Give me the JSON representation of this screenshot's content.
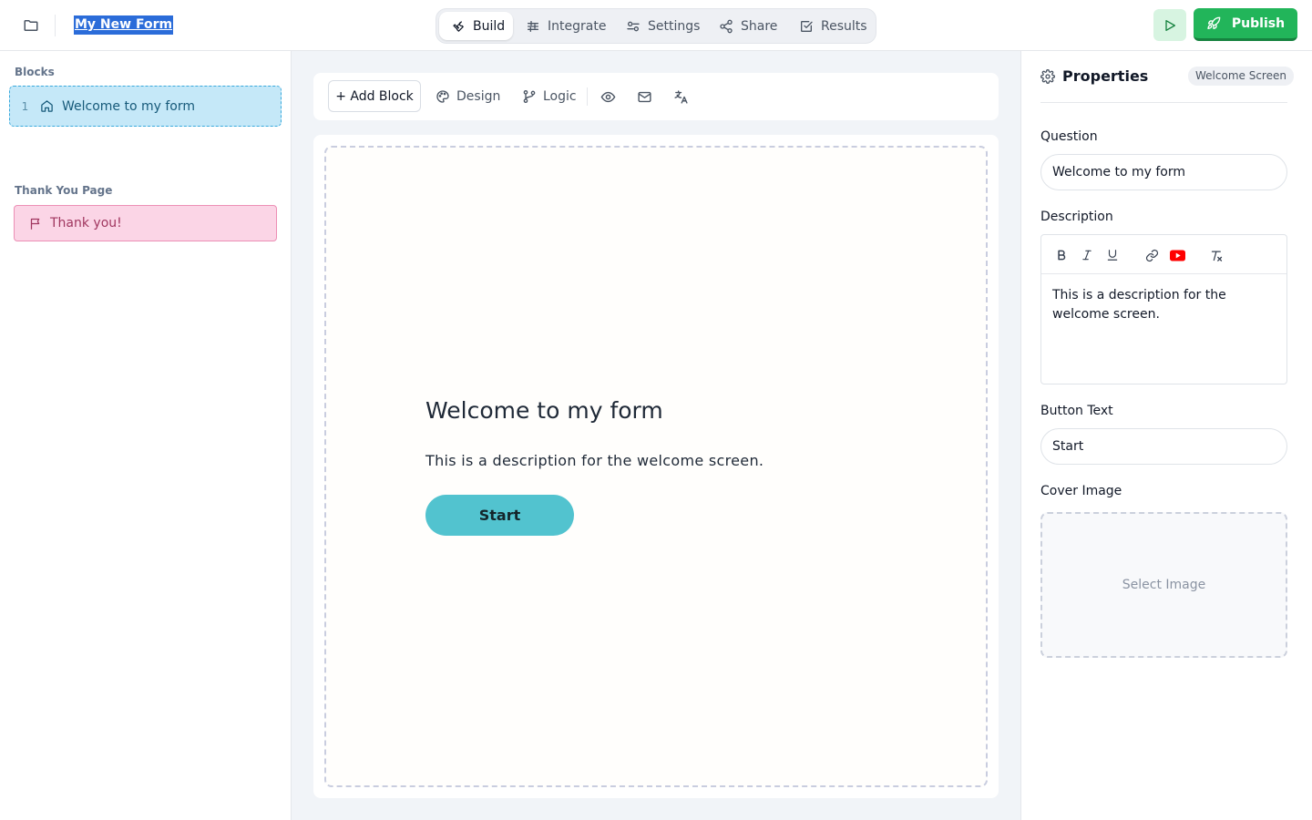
{
  "header": {
    "form_title": "My New Form",
    "nav_tabs": [
      {
        "label": "Build",
        "icon": "wrench-icon",
        "active": true
      },
      {
        "label": "Integrate",
        "icon": "sliders-icon"
      },
      {
        "label": "Settings",
        "icon": "settings-toggle-icon"
      },
      {
        "label": "Share",
        "icon": "share-icon"
      },
      {
        "label": "Results",
        "icon": "checkbox-icon"
      }
    ],
    "publish_label": "Publish",
    "colors": {
      "publish": "#22b55a",
      "run": "#d7f4e1",
      "title_highlight": "#2b6cd9"
    }
  },
  "sidebar": {
    "blocks_heading": "Blocks",
    "blocks": [
      {
        "number": "1",
        "label": "Welcome to my form",
        "icon": "home-icon"
      }
    ],
    "thank_you_heading": "Thank You Page",
    "thank_you": {
      "label": "Thank you!",
      "icon": "flag-icon"
    },
    "colors": {
      "block_bg": "#c5e8f8",
      "thank_you_bg": "#fbd5e6"
    }
  },
  "toolbar": {
    "add_block_label": "+ Add Block",
    "design_label": "Design",
    "logic_label": "Logic",
    "icons": [
      "palette-icon",
      "branch-icon",
      "eye-icon",
      "mail-icon",
      "translate-icon"
    ]
  },
  "canvas": {
    "title": "Welcome to my form",
    "description": "This is a description for the welcome screen.",
    "button_text": "Start",
    "colors": {
      "start_button": "#52c3cf"
    }
  },
  "properties": {
    "title": "Properties",
    "badge": "Welcome Screen",
    "question_label": "Question",
    "question_value": "Welcome to my form",
    "description_label": "Description",
    "description_value": "This is a description for the welcome screen.",
    "formatting_icons": [
      "bold-icon",
      "italic-icon",
      "underline-icon",
      "link-icon",
      "youtube-icon",
      "clear-format-icon"
    ],
    "button_text_label": "Button Text",
    "button_text_value": "Start",
    "cover_image_label": "Cover Image",
    "cover_image_placeholder": "Select Image"
  }
}
